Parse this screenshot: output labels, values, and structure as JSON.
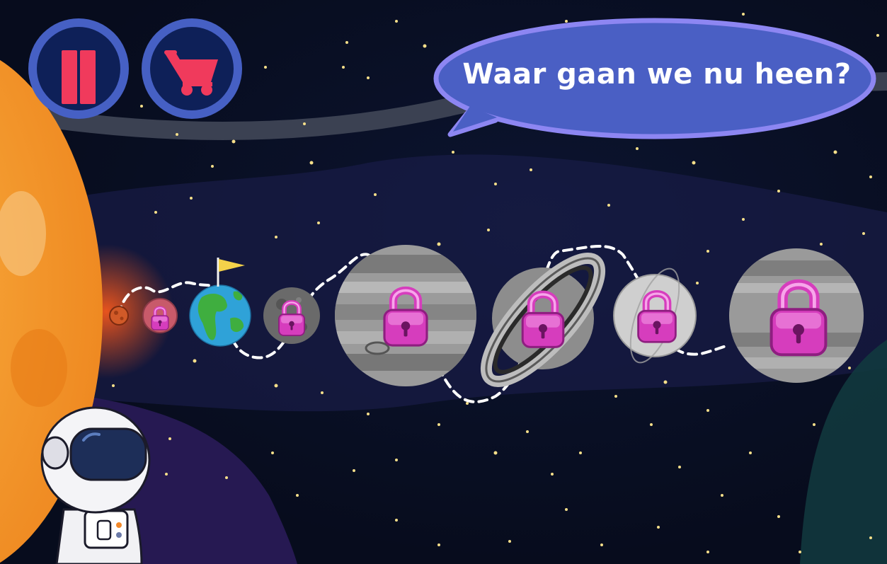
{
  "hud": {
    "pause_button": {
      "icon": "pause-icon",
      "color": "#f03a5c"
    },
    "shop_button": {
      "icon": "shopping-cart-icon",
      "color": "#f03a5c"
    },
    "button_ring_color": "#4660c4",
    "button_fill_color": "#0e2058"
  },
  "speech_bubble": {
    "text": "Waar gaan we nu heen?",
    "color": "#4a5fc4",
    "border_color": "#8d86f2"
  },
  "level_map": {
    "current_level": 3,
    "levels": [
      {
        "index": 1,
        "body": "sun-small",
        "state": "unlocked"
      },
      {
        "index": 2,
        "body": "red-planet-small",
        "state": "locked"
      },
      {
        "index": 3,
        "body": "earth",
        "state": "current"
      },
      {
        "index": 4,
        "body": "moon",
        "state": "locked"
      },
      {
        "index": 5,
        "body": "jupiter",
        "state": "locked"
      },
      {
        "index": 6,
        "body": "saturn",
        "state": "locked"
      },
      {
        "index": 7,
        "body": "uranus",
        "state": "locked"
      },
      {
        "index": 8,
        "body": "neptune",
        "state": "locked"
      }
    ],
    "lock_icon": "padlock-icon",
    "lock_color": "#d63dbd",
    "flag_color": "#f4d24a"
  },
  "characters": {
    "astronaut": "astronaut"
  }
}
